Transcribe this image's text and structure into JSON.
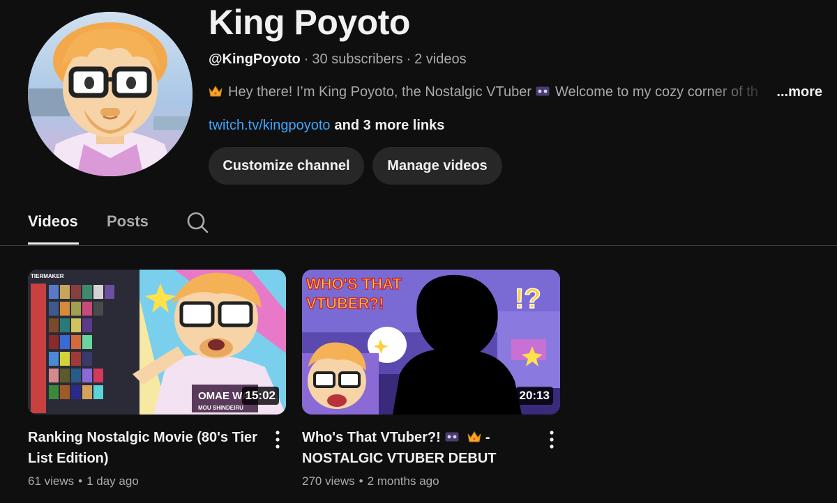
{
  "channel": {
    "name": "King Poyoto",
    "handle": "@KingPoyoto",
    "subscribers": "30 subscribers",
    "videos_count": "2 videos",
    "separator": "·",
    "description": "Hey there! I’m King Poyoto, the Nostalgic VTuber",
    "description_cont": "Welcome to my cozy corner of th",
    "more_label": "...more",
    "link_url": "twitch.tv/kingpoyoto",
    "link_extra": "and 3 more links",
    "avatar_icon": "avatar-illustration"
  },
  "actions": {
    "customize_label": "Customize channel",
    "manage_label": "Manage videos"
  },
  "tabs": {
    "videos_label": "Videos",
    "posts_label": "Posts",
    "search_icon": "search-icon"
  },
  "videos": [
    {
      "title": "Ranking Nostalgic Movie (80's Tier List Edition)",
      "duration": "15:02",
      "views": "61 views",
      "age": "1 day ago",
      "thumbnail_text_1": "TIERMAKER",
      "thumbnail_text_2": "OMAE WA",
      "thumbnail_text_3": "MOU SHINDEIRU"
    },
    {
      "title_part1": "Who's That VTuber?!",
      "title_part2": "-",
      "title_part3": "NOSTALGIC VTUBER DEBUT",
      "duration": "20:13",
      "views": "270 views",
      "age": "2 months ago",
      "thumbnail_text_1": "WHO'S THAT",
      "thumbnail_text_2": "VTUBER?!",
      "thumbnail_text_3": "!?"
    }
  ],
  "stats_dot": "•",
  "colors": {
    "background": "#0f0f0f",
    "text_primary": "#f1f1f1",
    "text_secondary": "#aaaaaa",
    "link": "#3ea6ff",
    "button_bg": "#272727"
  }
}
